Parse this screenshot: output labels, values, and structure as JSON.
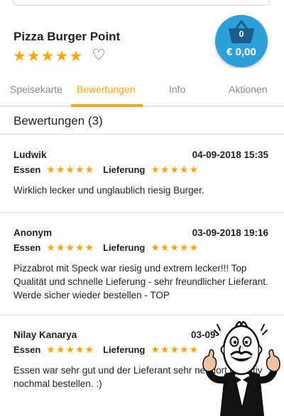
{
  "restaurant": {
    "name": "Pizza Burger Point",
    "rating": 5,
    "favorite_icon": "heart-outline-icon"
  },
  "cart": {
    "count": "0",
    "total": "€ 0,00",
    "icon": "basket-icon",
    "color": "#2f9fd9"
  },
  "tabs": [
    {
      "label": "Speisekarte",
      "active": false
    },
    {
      "label": "Bewertungen",
      "active": true
    },
    {
      "label": "Info",
      "active": false
    },
    {
      "label": "Aktionen",
      "active": false
    }
  ],
  "accent_color": "#f7a60f",
  "reviews_section": {
    "heading": "Bewertungen (3)",
    "food_label": "Essen",
    "delivery_label": "Lieferung",
    "items": [
      {
        "name": "Ludwik",
        "date": "04-09-2018 15:35",
        "food_rating": 5,
        "delivery_rating": 5,
        "text": "Wirklich lecker und unglaublich riesig Burger."
      },
      {
        "name": "Anonym",
        "date": "03-09-2018 19:16",
        "food_rating": 5,
        "delivery_rating": 5,
        "text": "Pizzabrot mit Speck war riesig und extrem lecker!!! Top Qualität und schnelle Lieferung - sehr freundlicher Lieferant. Werde sicher wieder bestellen - TOP"
      },
      {
        "name": "Nilay Kanarya",
        "date": "03-09-",
        "food_rating": 5,
        "delivery_rating": 5,
        "text": "Essen war sehr gut und der Lieferant sehr net dort definitiv nochmal bestellen. :)"
      }
    ]
  },
  "mascot": {
    "icon": "waiter-thumbs-up-icon"
  }
}
